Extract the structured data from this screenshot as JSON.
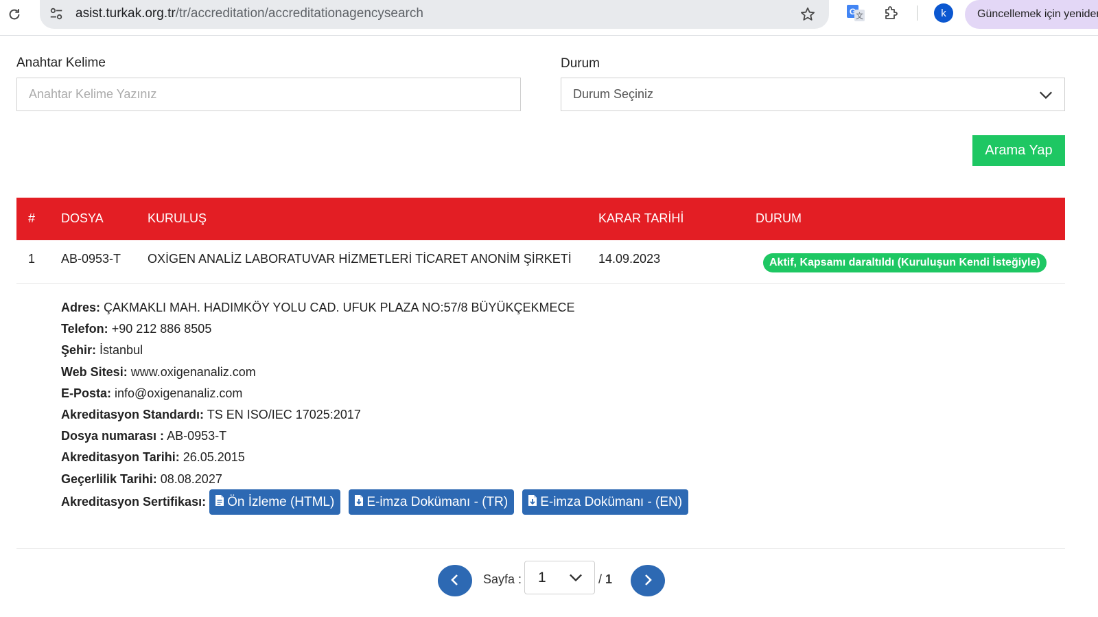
{
  "browser": {
    "url_host": "asist.turkak.org.tr",
    "url_path": "/tr/accreditation/accreditationagencysearch",
    "profile_initial": "k",
    "update_text": "Güncellemek için yeniden başlatın"
  },
  "form": {
    "keyword_label": "Anahtar Kelime",
    "keyword_placeholder": "Anahtar Kelime Yazınız",
    "status_label": "Durum",
    "status_selected": "Durum Seçiniz",
    "search_button": "Arama Yap"
  },
  "table": {
    "headers": [
      "#",
      "DOSYA",
      "KURULUŞ",
      "KARAR TARİHİ",
      "DURUM"
    ],
    "rows": [
      {
        "index": "1",
        "file": "AB-0953-T",
        "organization": "OXİGEN ANALİZ LABORATUVAR HİZMETLERİ TİCARET ANONİM ŞİRKETİ",
        "decision_date": "14.09.2023",
        "status": "Aktif, Kapsamı daraltıldı (Kuruluşun Kendi İsteğiyle)"
      }
    ]
  },
  "detail": {
    "address_label": "Adres:",
    "address": "ÇAKMAKLI MAH. HADIMKÖY YOLU CAD. UFUK PLAZA NO:57/8 BÜYÜKÇEKMECE",
    "phone_label": "Telefon:",
    "phone": "+90 212 886 8505",
    "city_label": "Şehir:",
    "city": "İstanbul",
    "website_label": "Web Sitesi:",
    "website": "www.oxigenanaliz.com",
    "email_label": "E-Posta:",
    "email": "info@oxigenanaliz.com",
    "standard_label": "Akreditasyon Standardı:",
    "standard": "TS EN ISO/IEC 17025:2017",
    "file_no_label": "Dosya numarası :",
    "file_no": "AB-0953-T",
    "accreditation_date_label": "Akreditasyon Tarihi:",
    "accreditation_date": "26.05.2015",
    "validity_date_label": "Geçerlilik Tarihi:",
    "validity_date": "08.08.2027",
    "certificate_label": "Akreditasyon Sertifikası:",
    "certificate_buttons": [
      "Ön İzleme (HTML)",
      "E-imza Dokümanı - (TR)",
      "E-imza Dokümanı - (EN)"
    ]
  },
  "pagination": {
    "page_label": "Sayfa :",
    "current_page": "1",
    "total_prefix": "/",
    "total_pages": "1"
  },
  "colors": {
    "header_red": "#e31e24",
    "action_green": "#1ec763",
    "button_blue": "#2d69b3"
  }
}
